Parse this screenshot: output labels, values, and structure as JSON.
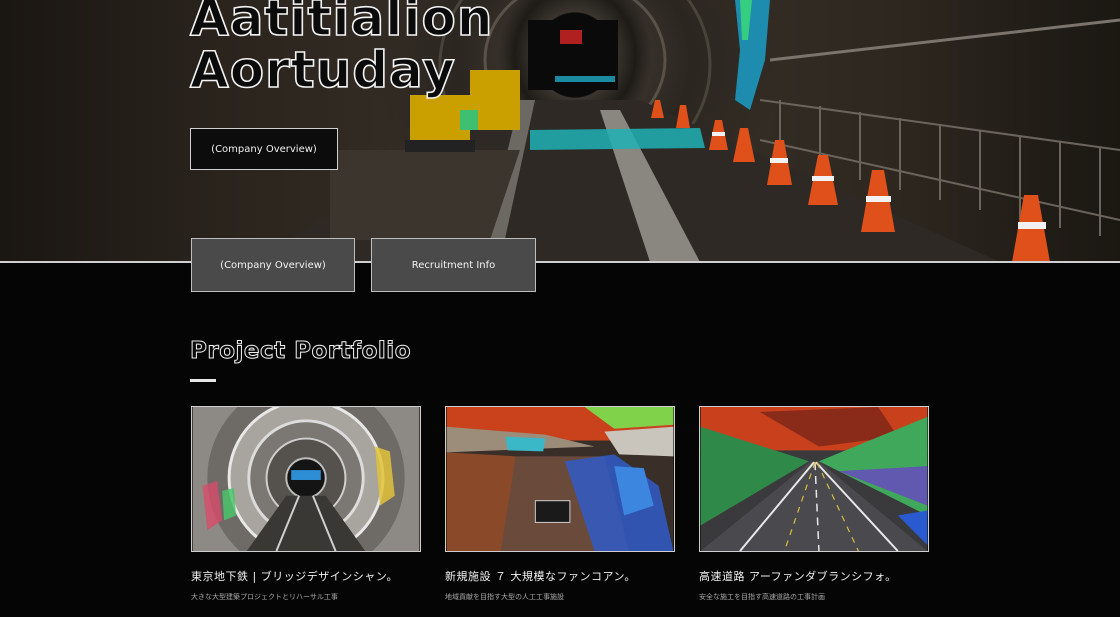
{
  "hero": {
    "title_line1": "Aatitialion",
    "title_line2": "Aortuday",
    "overview_button": "(Company Overview)"
  },
  "tabs": [
    {
      "label": "(Company Overview)"
    },
    {
      "label": "Recruitment Info"
    }
  ],
  "portfolio": {
    "title": "Project Portfolio",
    "cards": [
      {
        "title": "東京地下鉄 | ブリッジデザインシャン。",
        "desc": "大きな大型建築プロジェクトとリハーサル工事"
      },
      {
        "title": "新規施設 ７ 大規模なファンコアン。",
        "desc": "地域貢献を目指す大型の人工工事施設"
      },
      {
        "title": "高速道路 アーファンダブランシフォ。",
        "desc": "安全な施工を目指す高速道路の工事計画"
      }
    ]
  },
  "colors": {
    "background": "#050505",
    "tab_fill": "#4a4a4a",
    "text": "#f0f0f0"
  }
}
